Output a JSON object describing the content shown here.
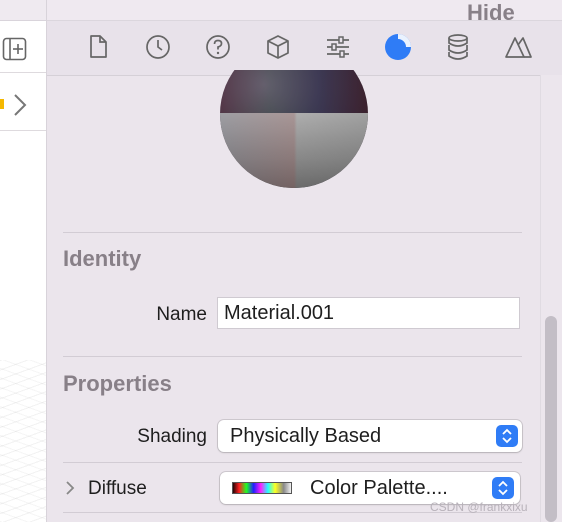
{
  "inspector_tabs": [
    {
      "icon": "document-icon"
    },
    {
      "icon": "clock-icon"
    },
    {
      "icon": "help-icon"
    },
    {
      "icon": "cube-icon"
    },
    {
      "icon": "sliders-icon",
      "selected": false
    },
    {
      "icon": "material-icon",
      "selected": true
    },
    {
      "icon": "physics-icon"
    },
    {
      "icon": "triangles-icon"
    }
  ],
  "colors": {
    "accent": "#2f7cf6",
    "warning": "#f5b800",
    "panel_bg": "#ebe5ec"
  },
  "identity": {
    "title": "Identity",
    "name_label": "Name",
    "name_value": "Material.001"
  },
  "properties": {
    "title": "Properties",
    "hide_label": "Hide",
    "shading_label": "Shading",
    "shading_value": "Physically Based",
    "diffuse_label": "Diffuse",
    "diffuse_value": "Color Palette...."
  },
  "watermark": "CSDN @frankxixu"
}
